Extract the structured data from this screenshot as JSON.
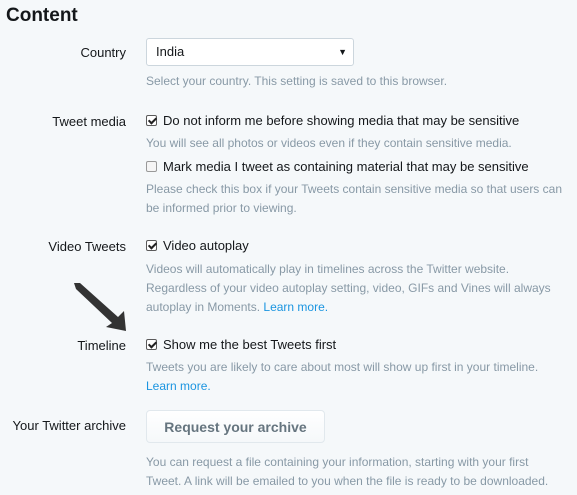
{
  "section": {
    "title": "Content"
  },
  "country": {
    "label": "Country",
    "selected": "India",
    "help": "Select your country. This setting is saved to this browser."
  },
  "tweet_media": {
    "label": "Tweet media",
    "option1": {
      "label": "Do not inform me before showing media that may be sensitive",
      "checked": true,
      "help": "You will see all photos or videos even if they contain sensitive media."
    },
    "option2": {
      "label": "Mark media I tweet as containing material that may be sensitive",
      "checked": false,
      "help_line1": "Please check this box if your Tweets contain sensitive media so that users can",
      "help_line2": "be informed prior to viewing."
    }
  },
  "video_tweets": {
    "label": "Video Tweets",
    "option": {
      "label": "Video autoplay",
      "checked": true
    },
    "help_line1": "Videos will automatically play in timelines across the Twitter website.",
    "help_line2": "Regardless of your video autoplay setting, video, GIFs and Vines will always",
    "help_line3_prefix": "autoplay in Moments. ",
    "learn_more": "Learn more."
  },
  "timeline": {
    "label": "Timeline",
    "option": {
      "label": "Show me the best Tweets first",
      "checked": true
    },
    "help_line1": "Tweets you are likely to care about most will show up first in your timeline.",
    "learn_more": "Learn more."
  },
  "archive": {
    "label": "Your Twitter archive",
    "button": "Request your archive",
    "help_line1": "You can request a file containing your information, starting with your first",
    "help_line2": "Tweet. A link will be emailed to you when the file is ready to be downloaded."
  },
  "colors": {
    "link": "#1b95e0",
    "help_text": "#8899a6",
    "background": "#f5f8fa"
  }
}
